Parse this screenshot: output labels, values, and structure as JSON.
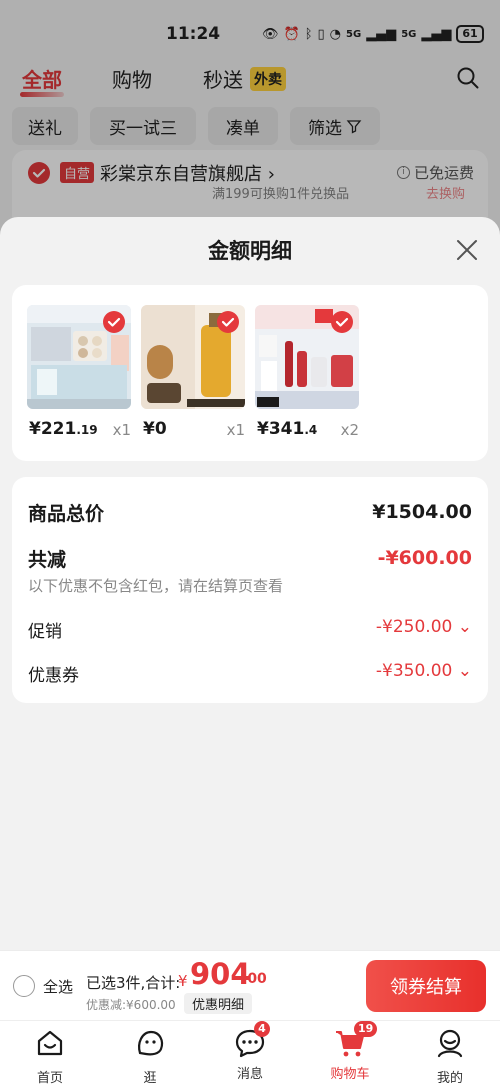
{
  "status_bar": {
    "time": "11:24",
    "battery": "61",
    "signal_1": "5G",
    "signal_2": "5G"
  },
  "top_tabs": [
    {
      "label": "全部"
    },
    {
      "label": "购物"
    },
    {
      "label": "秒送"
    }
  ],
  "waimai_tag": "外卖",
  "filters": [
    {
      "label": "送礼"
    },
    {
      "label": "买一试三"
    },
    {
      "label": "凑单"
    },
    {
      "label": "筛选"
    }
  ],
  "shop": {
    "tag": "自营",
    "name": "彩棠京东自营旗舰店",
    "chevron": "›",
    "free_shipping": "已免运费",
    "sub_text": "满199可换购1件兑换品",
    "sub_link": "去换购"
  },
  "sheet": {
    "title": "金额明细",
    "items": [
      {
        "price_main": "¥221",
        "price_dec": ".19",
        "qty": "x1"
      },
      {
        "price_main": "¥0",
        "price_dec": "",
        "qty": "x1"
      },
      {
        "price_main": "¥341",
        "price_dec": ".4",
        "qty": "x2"
      }
    ],
    "summary": {
      "total_label": "商品总价",
      "total_value": "¥1504.00",
      "reduce_label": "共减",
      "reduce_value": "-¥600.00",
      "reduce_note": "以下优惠不包含红包，请在结算页查看",
      "promo_label": "促销",
      "promo_value": "-¥250.00",
      "coupon_label": "优惠券",
      "coupon_value": "-¥350.00"
    }
  },
  "checkout": {
    "select_all": "全选",
    "selected_text": "已选3件,合计:",
    "total_yen": "¥",
    "total_int": "904",
    "total_dec": ".00",
    "discount_text": "优惠减:¥600.00",
    "detail_label": "优惠明细",
    "pay_label": "领券结算"
  },
  "bottom_nav": [
    {
      "label": "首页",
      "icon": "home-icon",
      "badge": ""
    },
    {
      "label": "逛",
      "icon": "browse-icon",
      "badge": ""
    },
    {
      "label": "消息",
      "icon": "message-icon",
      "badge": "4"
    },
    {
      "label": "购物车",
      "icon": "cart-icon",
      "badge": "19"
    },
    {
      "label": "我的",
      "icon": "profile-icon",
      "badge": ""
    }
  ],
  "colors": {
    "accent": "#e4393c",
    "sheet_bg": "#f2f2f2"
  }
}
